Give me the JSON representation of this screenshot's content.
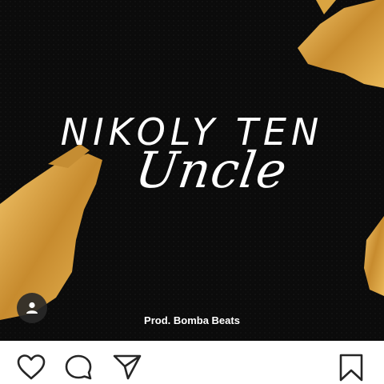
{
  "post": {
    "artist": "NIKOLY TEN",
    "title": "Uncle",
    "producer": "Prod. Bomba Beats"
  },
  "icons": {
    "profile": "user-icon",
    "like": "heart-icon",
    "comment": "comment-icon",
    "share": "send-icon",
    "save": "bookmark-icon"
  },
  "colors": {
    "background": "#0b0b0b",
    "gold": "#d9a441",
    "text": "#ffffff"
  }
}
